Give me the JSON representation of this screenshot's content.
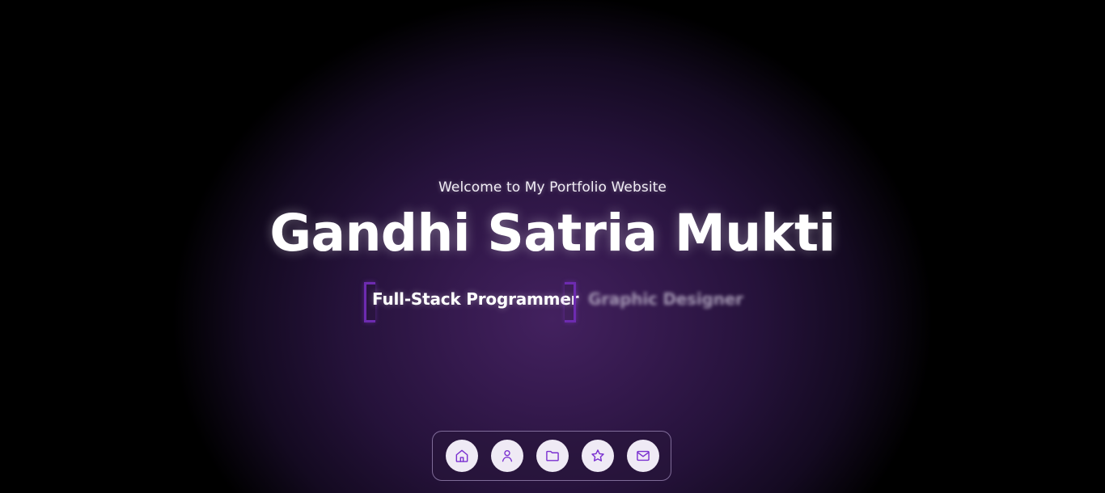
{
  "hero": {
    "welcome": "Welcome to My Portfolio Website",
    "name": "Gandhi Satria Mukti",
    "roles": {
      "active": "Full-Stack Programmer",
      "next": "Graphic Designer"
    }
  },
  "dock": {
    "items": [
      {
        "icon": "home-icon"
      },
      {
        "icon": "user-icon"
      },
      {
        "icon": "folder-icon"
      },
      {
        "icon": "star-icon"
      },
      {
        "icon": "mail-icon"
      }
    ]
  },
  "colors": {
    "accent": "#6d2bb0",
    "icon": "#7a2fd0",
    "button_bg": "#efeaf5",
    "glow_center": "#43215f",
    "background": "#000000"
  }
}
